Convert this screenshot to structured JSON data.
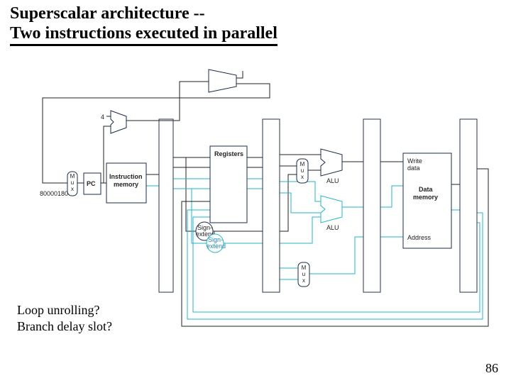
{
  "title_line1": "Superscalar architecture --",
  "title_line2": "Two instructions executed in parallel",
  "note_line1": "Loop unrolling?",
  "note_line2": "Branch delay slot?",
  "page_number": "86",
  "diagram": {
    "const_80000180": "80000180",
    "const_4": "4",
    "pc": "PC",
    "imem": "Instruction\nmemory",
    "regfile": "Registers",
    "signextend1": "Sign-\nextend",
    "signextend2": "Sign-\nextend",
    "alu1": "ALU",
    "alu2": "ALU",
    "dmem_write": "Write\ndata",
    "dmem_title": "Data\nmemory",
    "dmem_addr": "Address",
    "mux_label": "M\nu\nx"
  }
}
